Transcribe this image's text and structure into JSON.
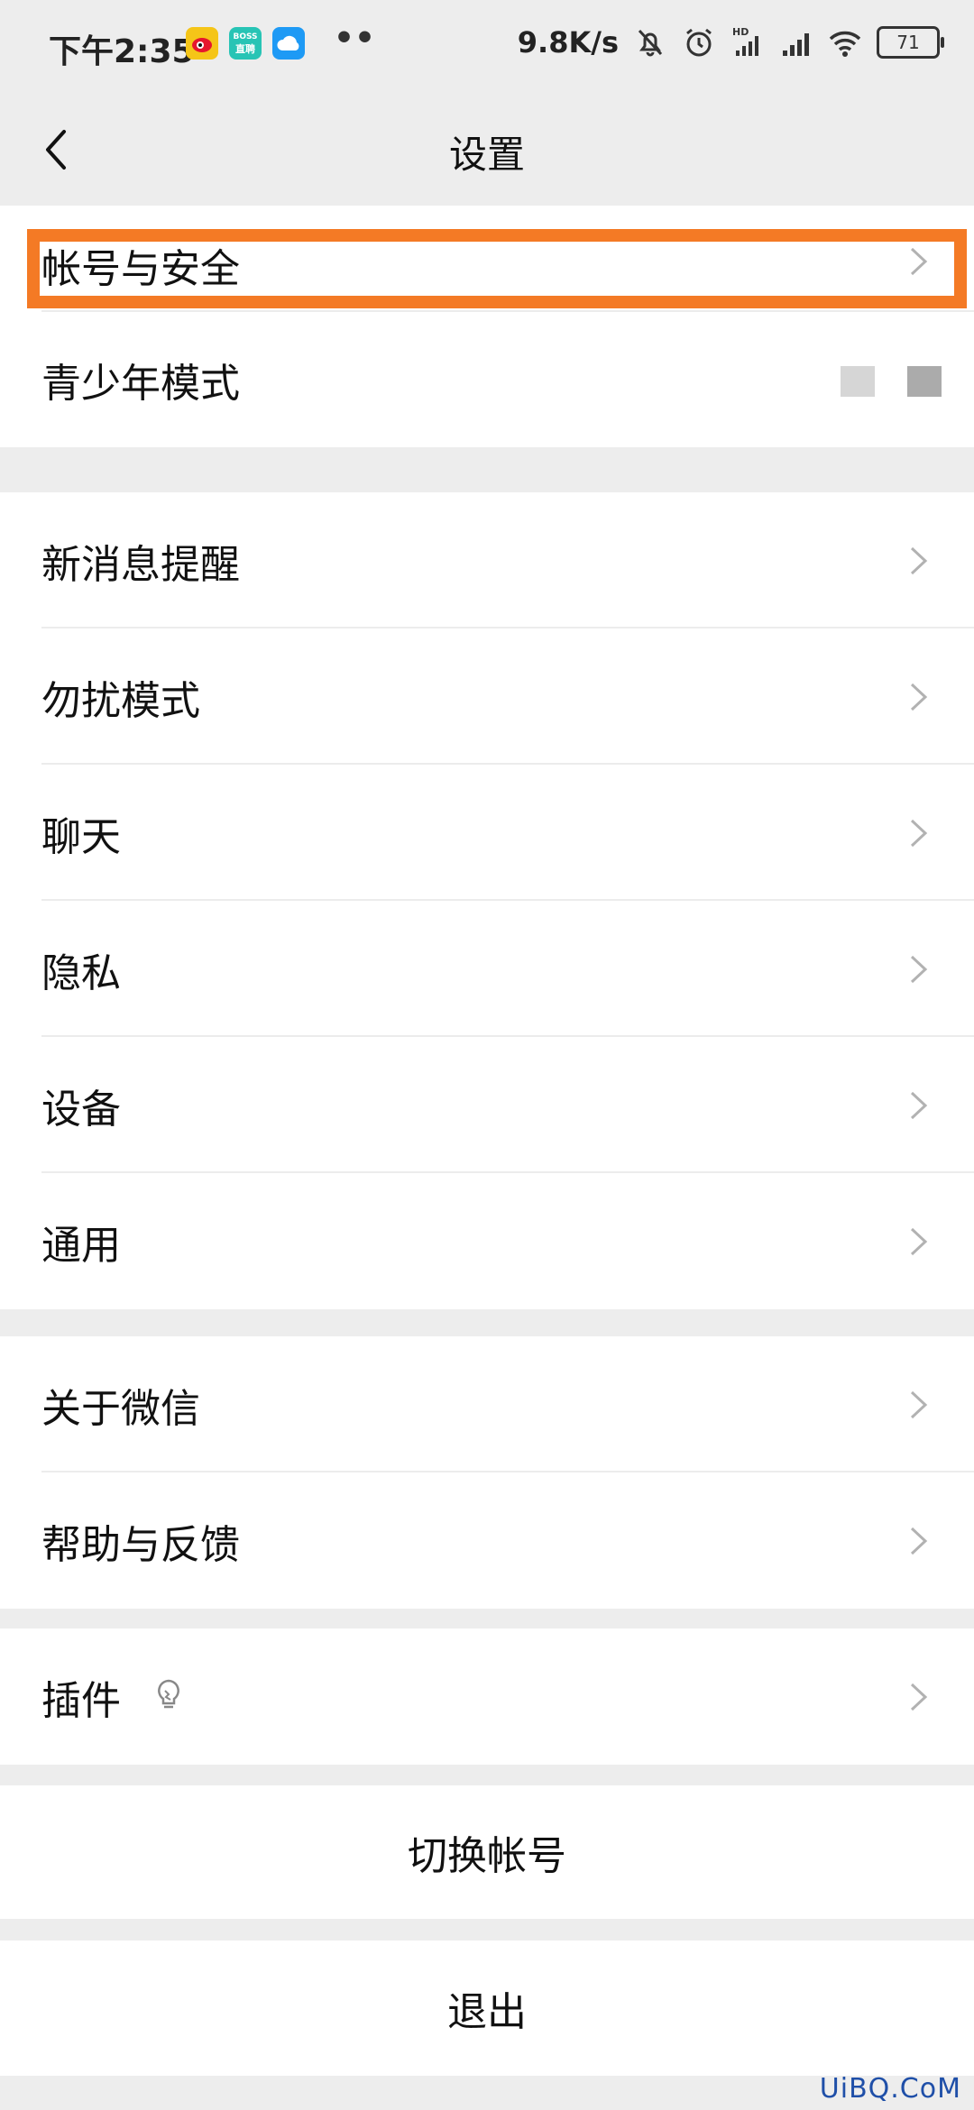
{
  "status_bar": {
    "time": "下午2:35",
    "app_icons": [
      "weibo-icon",
      "boss-zhipin-icon",
      "cloud-app-icon"
    ],
    "boss_label_top": "BOSS",
    "boss_label_bottom": "直聘",
    "more": "••",
    "net_speed": "9.8K/s",
    "battery": "71",
    "indicators": [
      "mute-bell-icon",
      "alarm-icon",
      "hd-signal-icon",
      "signal-icon",
      "wifi-icon"
    ]
  },
  "nav": {
    "title": "设置",
    "back_icon": "back-arrow-icon"
  },
  "groups": {
    "account": [
      {
        "label": "帐号与安全"
      },
      {
        "label": "青少年模式"
      }
    ],
    "main": [
      {
        "label": "新消息提醒"
      },
      {
        "label": "勿扰模式"
      },
      {
        "label": "聊天"
      },
      {
        "label": "隐私"
      },
      {
        "label": "设备"
      },
      {
        "label": "通用"
      }
    ],
    "about": [
      {
        "label": "关于微信"
      },
      {
        "label": "帮助与反馈"
      }
    ],
    "plugins": [
      {
        "label": "插件"
      }
    ]
  },
  "switch_account": "切换帐号",
  "logout": "退出",
  "watermark": "UiBQ.CoM",
  "colors": {
    "background": "#ededed",
    "highlight": "#f47a25",
    "chevron": "#b2b2b2"
  }
}
